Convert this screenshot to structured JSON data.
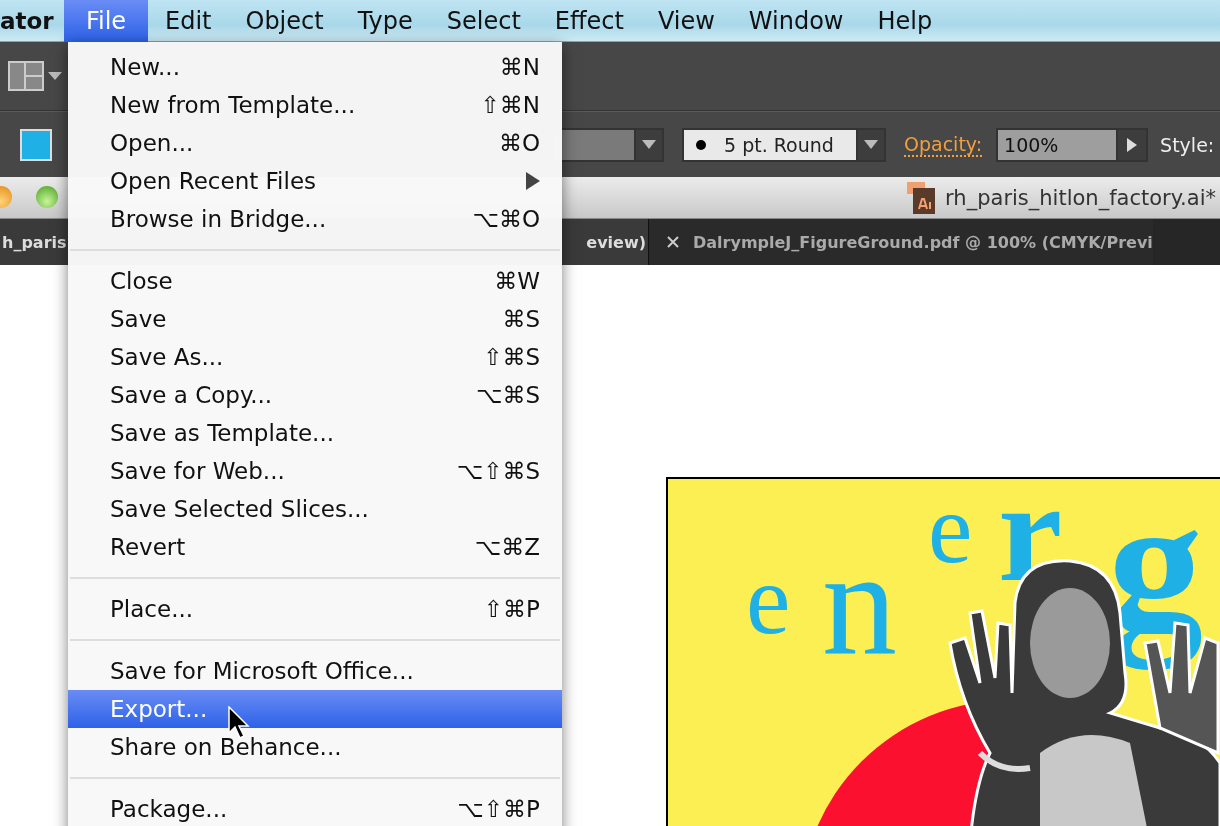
{
  "menu_bar": {
    "app_name": "ator",
    "menus": [
      {
        "label": "File",
        "selected": true
      },
      {
        "label": "Edit",
        "selected": false
      },
      {
        "label": "Object",
        "selected": false
      },
      {
        "label": "Type",
        "selected": false
      },
      {
        "label": "Select",
        "selected": false
      },
      {
        "label": "Effect",
        "selected": false
      },
      {
        "label": "View",
        "selected": false
      },
      {
        "label": "Window",
        "selected": false
      },
      {
        "label": "Help",
        "selected": false
      }
    ]
  },
  "control_bar": {
    "stroke_profile": "5 pt. Round",
    "opacity_label": "Opacity:",
    "opacity": "100%",
    "style_label": "Style:"
  },
  "document_window": {
    "title": "rh_paris_hitlon_factory.ai*"
  },
  "document_tabs": [
    {
      "visible_text": [
        "h_paris",
        "eview)"
      ],
      "selected": true
    },
    {
      "label": "DalrympleJ_FigureGround.pdf @ 100% (CMYK/Previ",
      "selected": false
    }
  ],
  "artboard": {
    "letters": [
      {
        "text": "e",
        "kind": "small"
      },
      {
        "text": "n",
        "kind": "large"
      },
      {
        "text": "e",
        "kind": "raised"
      },
      {
        "text": "r",
        "kind": "bold"
      },
      {
        "text": "g",
        "kind": "bold-large"
      }
    ]
  },
  "file_menu": {
    "items": [
      {
        "kind": "item",
        "label": "New...",
        "shortcut": "⌘N",
        "selected": false
      },
      {
        "kind": "item",
        "label": "New from Template...",
        "shortcut": "⇧⌘N",
        "selected": false
      },
      {
        "kind": "item",
        "label": "Open...",
        "shortcut": "⌘O",
        "selected": false
      },
      {
        "kind": "item",
        "label": "Open Recent Files",
        "submenu": true,
        "selected": false
      },
      {
        "kind": "item",
        "label": "Browse in Bridge...",
        "shortcut": "⌥⌘O",
        "selected": false
      },
      {
        "kind": "separator"
      },
      {
        "kind": "item",
        "label": "Close",
        "shortcut": "⌘W",
        "selected": false
      },
      {
        "kind": "item",
        "label": "Save",
        "shortcut": "⌘S",
        "selected": false
      },
      {
        "kind": "item",
        "label": "Save As...",
        "shortcut": "⇧⌘S",
        "selected": false
      },
      {
        "kind": "item",
        "label": "Save a Copy...",
        "shortcut": "⌥⌘S",
        "selected": false
      },
      {
        "kind": "item",
        "label": "Save as Template...",
        "selected": false
      },
      {
        "kind": "item",
        "label": "Save for Web...",
        "shortcut": "⌥⇧⌘S",
        "selected": false
      },
      {
        "kind": "item",
        "label": "Save Selected Slices...",
        "selected": false
      },
      {
        "kind": "item",
        "label": "Revert",
        "shortcut": "⌥⌘Z",
        "selected": false
      },
      {
        "kind": "separator"
      },
      {
        "kind": "item",
        "label": "Place...",
        "shortcut": "⇧⌘P",
        "selected": false
      },
      {
        "kind": "separator"
      },
      {
        "kind": "item",
        "label": "Save for Microsoft Office...",
        "selected": false
      },
      {
        "kind": "item",
        "label": "Export...",
        "selected": true
      },
      {
        "kind": "item",
        "label": "Share on Behance...",
        "selected": false
      },
      {
        "kind": "separator"
      },
      {
        "kind": "item",
        "label": "Package...",
        "shortcut": "⌥⇧⌘P",
        "selected": false
      }
    ]
  }
}
